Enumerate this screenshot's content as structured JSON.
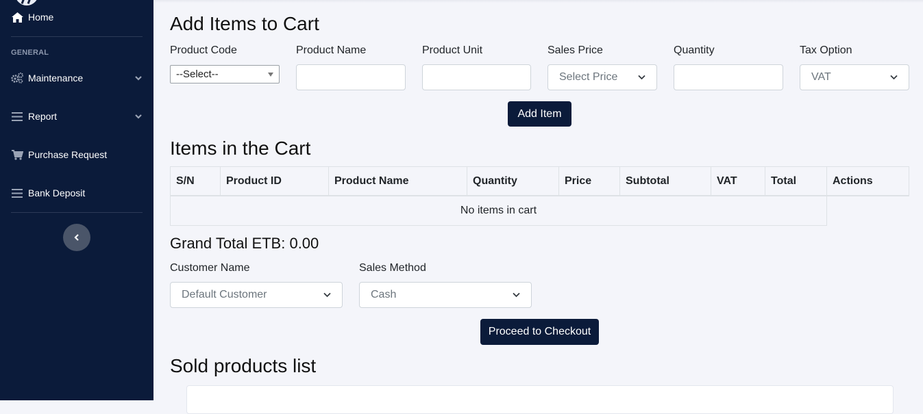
{
  "sidebar": {
    "home_label": "Home",
    "section_label": "GENERAL",
    "items": [
      {
        "label": "Maintenance",
        "icon": "gears-icon",
        "has_submenu": true
      },
      {
        "label": "Report",
        "icon": "list-icon",
        "has_submenu": true
      },
      {
        "label": "Purchase Request",
        "icon": "cart-icon",
        "has_submenu": false
      },
      {
        "label": "Bank Deposit",
        "icon": "list-icon",
        "has_submenu": false
      }
    ],
    "collapse_icon": "chevron-left-icon"
  },
  "add_items": {
    "title": "Add Items to Cart",
    "product_code_label": "Product Code",
    "product_code_value": "--Select--",
    "product_name_label": "Product Name",
    "product_name_value": "",
    "product_unit_label": "Product Unit",
    "product_unit_value": "",
    "sales_price_label": "Sales Price",
    "sales_price_value": "Select Price",
    "quantity_label": "Quantity",
    "quantity_value": "",
    "tax_option_label": "Tax Option",
    "tax_option_value": "VAT",
    "add_button": "Add Item"
  },
  "cart": {
    "title": "Items in the Cart",
    "columns": [
      "S/N",
      "Product ID",
      "Product Name",
      "Quantity",
      "Price",
      "Subtotal",
      "VAT",
      "Total",
      "Actions"
    ],
    "empty_text": "No items in cart"
  },
  "checkout": {
    "grand_total": "Grand Total ETB: 0.00",
    "customer_label": "Customer Name",
    "customer_value": "Default Customer",
    "sales_method_label": "Sales Method",
    "sales_method_value": "Cash",
    "proceed_button": "Proceed to Checkout"
  },
  "sold": {
    "title": "Sold products list"
  },
  "colors": {
    "sidebar_bg": "#0b1b3a",
    "primary_button": "#0b1b3a",
    "page_bg": "#f4f5fa"
  }
}
